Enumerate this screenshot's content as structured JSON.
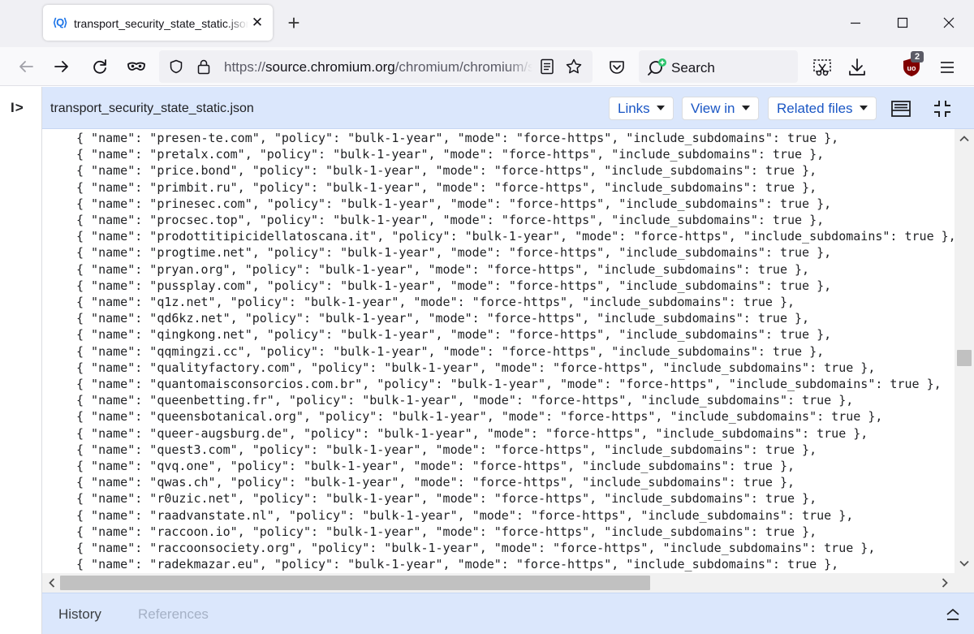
{
  "browser": {
    "tab": {
      "title": "transport_security_state_static.json",
      "favicon_text": "⟨Q⟩"
    },
    "url": {
      "scheme": "https://",
      "host": "source.chromium.org",
      "path": "/chromium/chromium/src/+/main:net/http/transport_security_state_static.json"
    },
    "search": {
      "placeholder": "Search"
    },
    "extension_badge": "2",
    "icons": {
      "back": "back-arrow-icon",
      "forward": "forward-arrow-icon",
      "reload": "reload-icon",
      "private": "mask-icon",
      "shield": "tracking-shield-icon",
      "lock": "lock-icon",
      "reader": "reader-view-icon",
      "bookmark": "bookmark-star-icon",
      "pocket": "pocket-icon",
      "screenshot": "screenshot-icon",
      "downloads": "download-icon",
      "ublock": "ublock-origin-icon",
      "menu": "hamburger-menu-icon"
    },
    "accent_color": "#1a73e8"
  },
  "codesearch": {
    "filename": "transport_security_state_static.json",
    "buttons": {
      "links": "Links",
      "view_in": "View in",
      "related_files": "Related files"
    },
    "rail_toggle": "I>",
    "header_color": "#dbe7fc",
    "lines": [
      "{ \"name\": \"presen-te.com\", \"policy\": \"bulk-1-year\", \"mode\": \"force-https\", \"include_subdomains\": true },",
      "{ \"name\": \"pretalx.com\", \"policy\": \"bulk-1-year\", \"mode\": \"force-https\", \"include_subdomains\": true },",
      "{ \"name\": \"price.bond\", \"policy\": \"bulk-1-year\", \"mode\": \"force-https\", \"include_subdomains\": true },",
      "{ \"name\": \"primbit.ru\", \"policy\": \"bulk-1-year\", \"mode\": \"force-https\", \"include_subdomains\": true },",
      "{ \"name\": \"prinesec.com\", \"policy\": \"bulk-1-year\", \"mode\": \"force-https\", \"include_subdomains\": true },",
      "{ \"name\": \"procsec.top\", \"policy\": \"bulk-1-year\", \"mode\": \"force-https\", \"include_subdomains\": true },",
      "{ \"name\": \"prodottitipicidellatoscana.it\", \"policy\": \"bulk-1-year\", \"mode\": \"force-https\", \"include_subdomains\": true },",
      "{ \"name\": \"progtime.net\", \"policy\": \"bulk-1-year\", \"mode\": \"force-https\", \"include_subdomains\": true },",
      "{ \"name\": \"pryan.org\", \"policy\": \"bulk-1-year\", \"mode\": \"force-https\", \"include_subdomains\": true },",
      "{ \"name\": \"pussplay.com\", \"policy\": \"bulk-1-year\", \"mode\": \"force-https\", \"include_subdomains\": true },",
      "{ \"name\": \"q1z.net\", \"policy\": \"bulk-1-year\", \"mode\": \"force-https\", \"include_subdomains\": true },",
      "{ \"name\": \"qd6kz.net\", \"policy\": \"bulk-1-year\", \"mode\": \"force-https\", \"include_subdomains\": true },",
      "{ \"name\": \"qingkong.net\", \"policy\": \"bulk-1-year\", \"mode\": \"force-https\", \"include_subdomains\": true },",
      "{ \"name\": \"qqmingzi.cc\", \"policy\": \"bulk-1-year\", \"mode\": \"force-https\", \"include_subdomains\": true },",
      "{ \"name\": \"qualityfactory.com\", \"policy\": \"bulk-1-year\", \"mode\": \"force-https\", \"include_subdomains\": true },",
      "{ \"name\": \"quantomaisconsorcios.com.br\", \"policy\": \"bulk-1-year\", \"mode\": \"force-https\", \"include_subdomains\": true },",
      "{ \"name\": \"queenbetting.fr\", \"policy\": \"bulk-1-year\", \"mode\": \"force-https\", \"include_subdomains\": true },",
      "{ \"name\": \"queensbotanical.org\", \"policy\": \"bulk-1-year\", \"mode\": \"force-https\", \"include_subdomains\": true },",
      "{ \"name\": \"queer-augsburg.de\", \"policy\": \"bulk-1-year\", \"mode\": \"force-https\", \"include_subdomains\": true },",
      "{ \"name\": \"quest3.com\", \"policy\": \"bulk-1-year\", \"mode\": \"force-https\", \"include_subdomains\": true },",
      "{ \"name\": \"qvq.one\", \"policy\": \"bulk-1-year\", \"mode\": \"force-https\", \"include_subdomains\": true },",
      "{ \"name\": \"qwas.ch\", \"policy\": \"bulk-1-year\", \"mode\": \"force-https\", \"include_subdomains\": true },",
      "{ \"name\": \"r0uzic.net\", \"policy\": \"bulk-1-year\", \"mode\": \"force-https\", \"include_subdomains\": true },",
      "{ \"name\": \"raadvanstate.nl\", \"policy\": \"bulk-1-year\", \"mode\": \"force-https\", \"include_subdomains\": true },",
      "{ \"name\": \"raccoon.io\", \"policy\": \"bulk-1-year\", \"mode\": \"force-https\", \"include_subdomains\": true },",
      "{ \"name\": \"raccoonsociety.org\", \"policy\": \"bulk-1-year\", \"mode\": \"force-https\", \"include_subdomains\": true },",
      "{ \"name\": \"radekmazar.eu\", \"policy\": \"bulk-1-year\", \"mode\": \"force-https\", \"include_subdomains\": true },"
    ]
  },
  "bottom_panel": {
    "tabs": [
      "History",
      "References"
    ]
  }
}
